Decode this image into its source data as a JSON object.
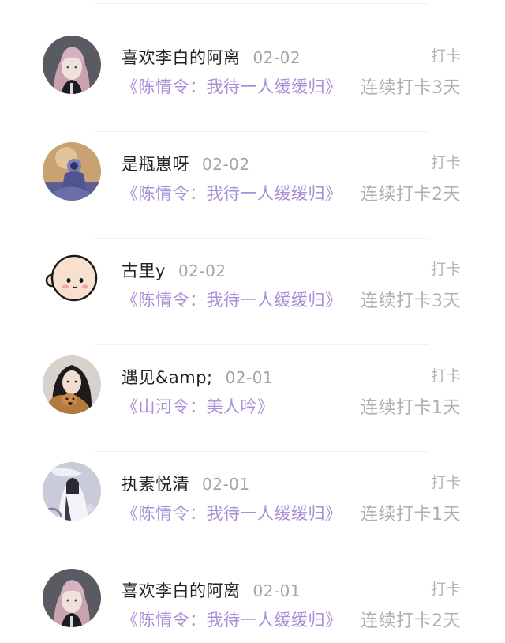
{
  "entries": [
    {
      "user": "喜欢李白的阿离",
      "date": "02-02",
      "action": "打卡",
      "book": "《陈情令：我待一人缓缓归》",
      "streak": "连续打卡3天",
      "avatar": "pink-haired-girl-avatar"
    },
    {
      "user": "是瓶崽呀",
      "date": "02-02",
      "action": "打卡",
      "book": "《陈情令：我待一人缓缓归》",
      "streak": "连续打卡2天",
      "avatar": "astronaut-avatar"
    },
    {
      "user": "古里y",
      "date": "02-02",
      "action": "打卡",
      "book": "《陈情令：我待一人缓缓归》",
      "streak": "连续打卡3天",
      "avatar": "cartoon-bald-head-avatar"
    },
    {
      "user": "遇见&amp;",
      "date": "02-01",
      "action": "打卡",
      "book": "《山河令：美人吟》",
      "streak": "连续打卡1天",
      "avatar": "girl-with-dog-avatar"
    },
    {
      "user": "执素悦清",
      "date": "02-01",
      "action": "打卡",
      "book": "《陈情令：我待一人缓缓归》",
      "streak": "连续打卡1天",
      "avatar": "white-robed-figure-avatar"
    },
    {
      "user": "喜欢李白的阿离",
      "date": "02-01",
      "action": "打卡",
      "book": "《陈情令：我待一人缓缓归》",
      "streak": "连续打卡2天",
      "avatar": "pink-haired-girl-avatar"
    }
  ]
}
